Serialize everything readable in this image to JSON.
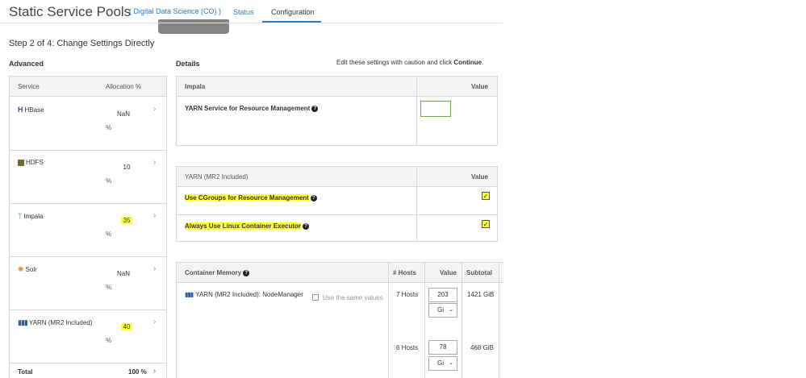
{
  "header": {
    "title": "Static Service Pools",
    "cluster_link": "( Digital Data Science (CO) )",
    "tabs": [
      "Status",
      "Configuration"
    ]
  },
  "step": "Step 2 of 4: Change Settings Directly",
  "sections": {
    "advanced": "Advanced",
    "details": "Details",
    "note_prefix": "Edit these settings with caution and click ",
    "note_action": "Continue",
    "note_suffix": "."
  },
  "allocation": {
    "col_service": "Service",
    "col_allocation": "Allocation %",
    "rows": [
      {
        "name": "HBase",
        "icon": "hbase-icon",
        "value": "NaN",
        "unit": "%"
      },
      {
        "name": "HDFS",
        "icon": "hdfs-icon",
        "value": "10",
        "unit": "%"
      },
      {
        "name": "Impala",
        "icon": "impala-icon",
        "value": "35",
        "unit": "%"
      },
      {
        "name": "Solr",
        "icon": "solr-icon",
        "value": "NaN",
        "unit": "%"
      },
      {
        "name": "YARN (MR2 Included)",
        "icon": "yarn-icon",
        "value": "40",
        "unit": "%"
      }
    ],
    "total_label": "Total",
    "total_value": "100 %"
  },
  "impala_table": {
    "header": "Impala",
    "value_header": "Value",
    "rows": [
      {
        "label": "YARN Service for Resource Management",
        "value": ""
      }
    ]
  },
  "yarn_table": {
    "header": "YARN (MR2 Included)",
    "value_header": "Value",
    "rows": [
      {
        "label": "Use CGroups for Resource Management",
        "checked": true
      },
      {
        "label": "Always Use Linux Container Executor",
        "checked": true
      }
    ]
  },
  "memory_table": {
    "header": "Container Memory",
    "col_hosts": "# Hosts",
    "col_value": "Value",
    "col_subtotal": "Subtotal",
    "role": "YARN (MR2 Included): NodeManager",
    "same_values_label": "Use the same values",
    "rows": [
      {
        "hosts": "7 Hosts",
        "value": "203",
        "unit": "Gi",
        "subtotal": "1421 GiB"
      },
      {
        "hosts": "6 Hosts",
        "value": "78",
        "unit": "Gi",
        "subtotal": "468 GiB"
      }
    ]
  },
  "colors": {
    "accent": "#2a7cb9",
    "highlight": "#ffff3a",
    "input_border": "#6aa84f"
  }
}
